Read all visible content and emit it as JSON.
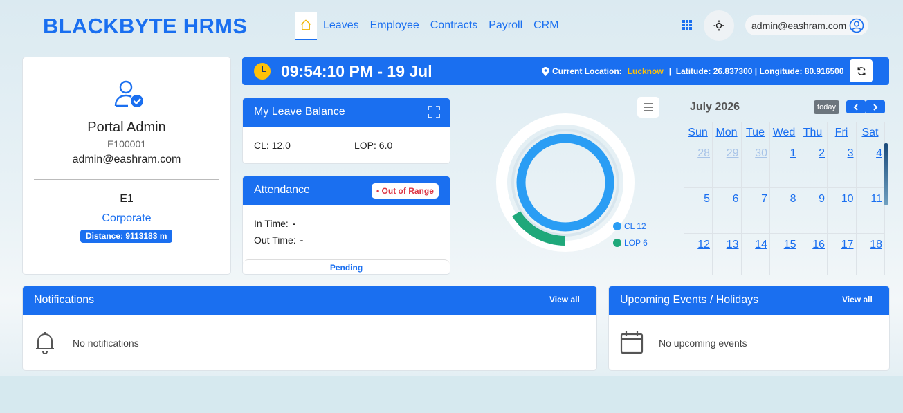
{
  "header": {
    "brand": "BLACKBYTE HRMS",
    "nav": [
      "Leaves",
      "Employee",
      "Contracts",
      "Payroll",
      "CRM"
    ],
    "user_email": "admin@eashram.com",
    "accent": "#1a6ff0"
  },
  "profile": {
    "name": "Portal Admin",
    "employee_id": "E100001",
    "email": "admin@eashram.com",
    "code": "E1",
    "department": "Corporate",
    "distance": "Distance: 9113183 m"
  },
  "clock": {
    "time": "09:54:10 PM - 19 Jul",
    "location_label": "Current Location:",
    "city": "Lucknow",
    "coords": "Latitude: 26.837300 | Longitude: 80.916500"
  },
  "leave_balance": {
    "title": "My Leave Balance",
    "cl": "CL: 12.0",
    "lop": "LOP: 6.0"
  },
  "attendance": {
    "title": "Attendance",
    "badge": "• Out of Range",
    "in_label": "In Time:",
    "in_value": "-",
    "out_label": "Out Time:",
    "out_value": "-",
    "status": "Pending"
  },
  "chart_data": {
    "type": "pie",
    "variant": "donut",
    "series": [
      {
        "name": "CL 12",
        "value": 12,
        "color": "#2a9df4"
      },
      {
        "name": "LOP 6",
        "value": 6,
        "color": "#1fa87a"
      }
    ],
    "legend": [
      "CL 12",
      "LOP 6"
    ]
  },
  "calendar": {
    "title": "July 2026",
    "today": "today",
    "days": [
      "Sun",
      "Mon",
      "Tue",
      "Wed",
      "Thu",
      "Fri",
      "Sat"
    ],
    "weeks": [
      [
        {
          "d": "28",
          "m": true
        },
        {
          "d": "29",
          "m": true
        },
        {
          "d": "30",
          "m": true
        },
        {
          "d": "1"
        },
        {
          "d": "2"
        },
        {
          "d": "3"
        },
        {
          "d": "4"
        }
      ],
      [
        {
          "d": "5"
        },
        {
          "d": "6"
        },
        {
          "d": "7"
        },
        {
          "d": "8"
        },
        {
          "d": "9"
        },
        {
          "d": "10"
        },
        {
          "d": "11"
        }
      ],
      [
        {
          "d": "12"
        },
        {
          "d": "13"
        },
        {
          "d": "14"
        },
        {
          "d": "15"
        },
        {
          "d": "16"
        },
        {
          "d": "17"
        },
        {
          "d": "18"
        }
      ]
    ]
  },
  "notifications": {
    "title": "Notifications",
    "view_all": "View all",
    "empty": "No notifications"
  },
  "events": {
    "title": "Upcoming Events / Holidays",
    "view_all": "View all",
    "empty": "No upcoming events"
  }
}
